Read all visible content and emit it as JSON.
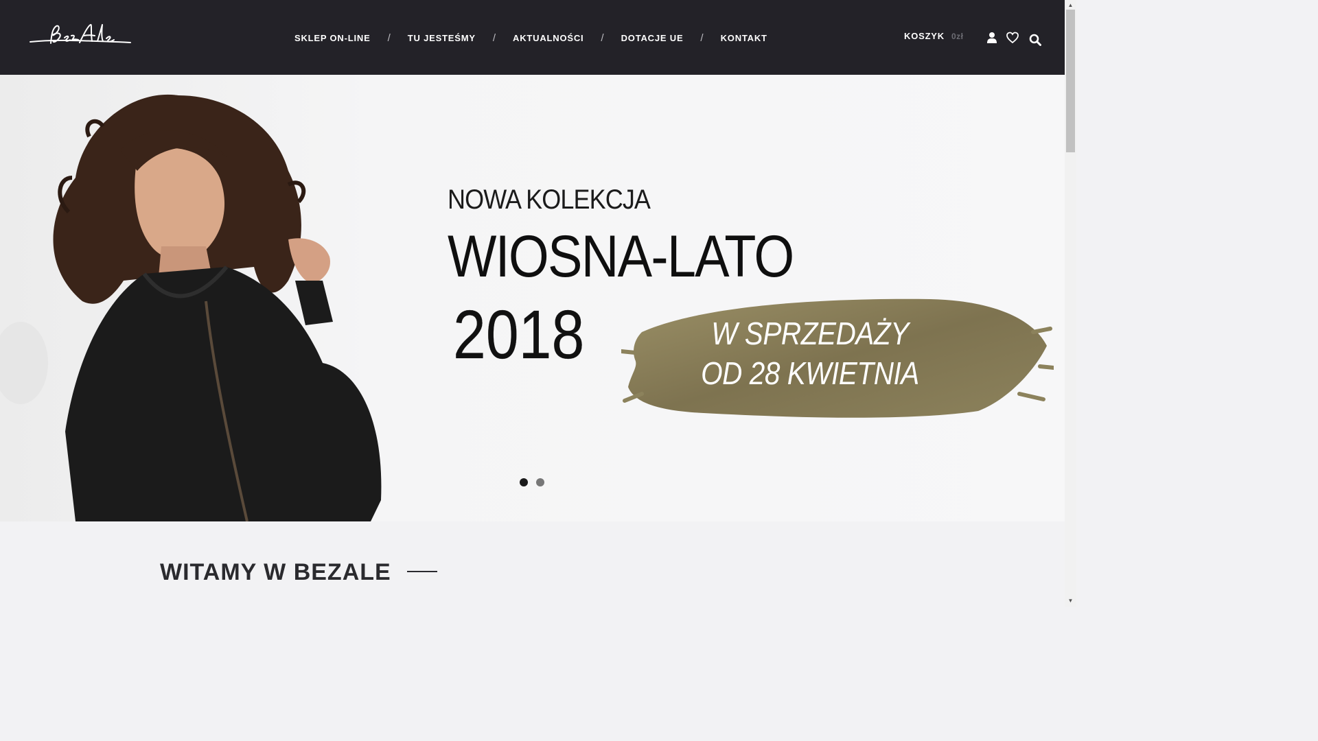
{
  "header": {
    "logo_alt": "BezAle",
    "nav": [
      {
        "label": "SKLEP ON-LINE"
      },
      {
        "label": "TU JESTEŚMY"
      },
      {
        "label": "AKTUALNOŚCI"
      },
      {
        "label": "DOTACJE UE"
      },
      {
        "label": "KONTAKT"
      }
    ],
    "separator": "/",
    "cart": {
      "label": "KOSZYK",
      "total": "0zł"
    },
    "icons": [
      "user-icon",
      "heart-icon",
      "search-icon"
    ]
  },
  "hero": {
    "line1": "NOWA KOLEKCJA",
    "line2": "WIOSNA-LATO",
    "line3": "2018",
    "badge_line1": "W SPRZEDAŻY",
    "badge_line2": "OD 28 KWIETNIA",
    "slides": 2,
    "active_slide": 1,
    "colors": {
      "badge": "#8a7f5a",
      "dot_active": "#1a1a1a",
      "dot_inactive": "#777777"
    }
  },
  "welcome": {
    "title": "WITAMY W BEZALE"
  },
  "colors": {
    "header_bg": "#232228",
    "page_bg": "#f2f2f4"
  }
}
